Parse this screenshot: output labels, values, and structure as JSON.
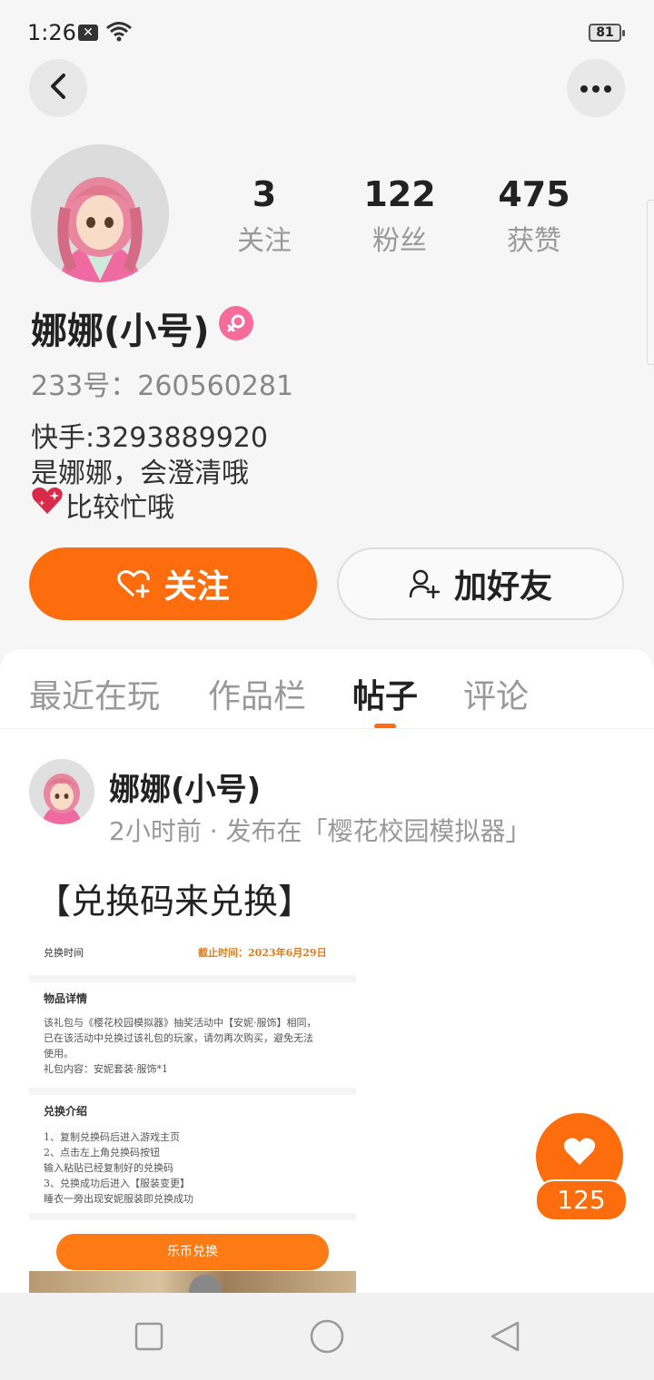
{
  "status_bar": {
    "time": "1:26",
    "sim_badge": "✕",
    "battery": "81"
  },
  "profile": {
    "stats": [
      {
        "value": "3",
        "label": "关注"
      },
      {
        "value": "122",
        "label": "粉丝"
      },
      {
        "value": "475",
        "label": "获赞"
      }
    ],
    "name": "娜娜(小号)",
    "uid": "233号：260560281",
    "bio_lines": [
      "快手:3293889920",
      "是娜娜，会澄清哦",
      "比较忙哦"
    ]
  },
  "actions": {
    "follow_label": "关注",
    "add_friend_label": "加好友"
  },
  "tabs": [
    {
      "label": "最近在玩",
      "active": false
    },
    {
      "label": "作品栏",
      "active": false
    },
    {
      "label": "帖子",
      "active": true
    },
    {
      "label": "评论",
      "active": false
    }
  ],
  "post": {
    "author": "娜娜(小号)",
    "meta": "2小时前 · 发布在「樱花校园模拟器」",
    "title": "【兑换码来兑换】",
    "image": {
      "time_label": "兑换时间",
      "deadline": "截止时间：2023年6月29日",
      "details_heading": "物品详情",
      "details_text": [
        "该礼包与《樱花校园模拟器》抽奖活动中【安妮·服饰】相同，",
        "已在该活动中兑换过该礼包的玩家，请勿再次购买，避免无法",
        "使用。",
        "礼包内容：安妮套装·服饰*1"
      ],
      "intro_heading": "兑换介绍",
      "intro_text": [
        "1、复制兑换码后进入游戏主页",
        "2、点击左上角兑换码按钮",
        "输入粘贴已经复制好的兑换码",
        "3、兑换成功后进入【服装变更】",
        "睡衣一旁出现安妮服装即兑换成功"
      ],
      "redeem_button": "乐币兑换"
    },
    "likes": "125"
  },
  "colors": {
    "accent": "#fd6d0d",
    "gender_badge": "#f56c9a"
  }
}
